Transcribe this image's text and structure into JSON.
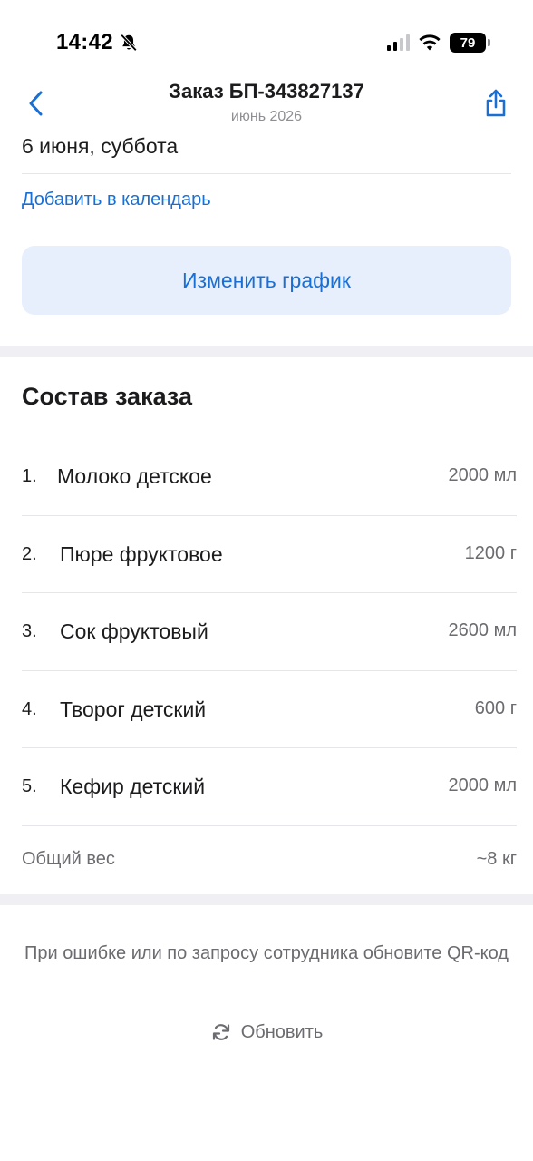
{
  "status_bar": {
    "time": "14:42",
    "battery": "79"
  },
  "nav": {
    "title": "Заказ БП-343827137",
    "subtitle": "июнь 2026"
  },
  "schedule": {
    "date": "6 июня, суббота",
    "add_to_calendar": "Добавить в календарь",
    "change_button": "Изменить график"
  },
  "order": {
    "title": "Состав заказа",
    "items": [
      {
        "num": "1.",
        "name": "Молоко детское",
        "qty": "2000 мл"
      },
      {
        "num": "2.",
        "name": "Пюре фруктовое",
        "qty": "1200 г"
      },
      {
        "num": "3.",
        "name": "Сок фруктовый",
        "qty": "2600 мл"
      },
      {
        "num": "4.",
        "name": "Творог детский",
        "qty": "600 г"
      },
      {
        "num": "5.",
        "name": "Кефир детский",
        "qty": "2000 мл"
      }
    ],
    "total_label": "Общий вес",
    "total_value": "~8 кг"
  },
  "footer": {
    "note": "При ошибке или по запросу сотрудника обновите QR-код",
    "refresh_label": "Обновить"
  },
  "colors": {
    "accent": "#1a6fd4",
    "button_bg": "#e7effc",
    "separator": "#efeff4"
  },
  "icons": {
    "mute": "bell-slash-icon",
    "signal": "cellular-signal-icon",
    "wifi": "wifi-icon",
    "battery": "battery-icon",
    "back": "chevron-left-icon",
    "share": "share-icon",
    "refresh": "refresh-icon"
  }
}
